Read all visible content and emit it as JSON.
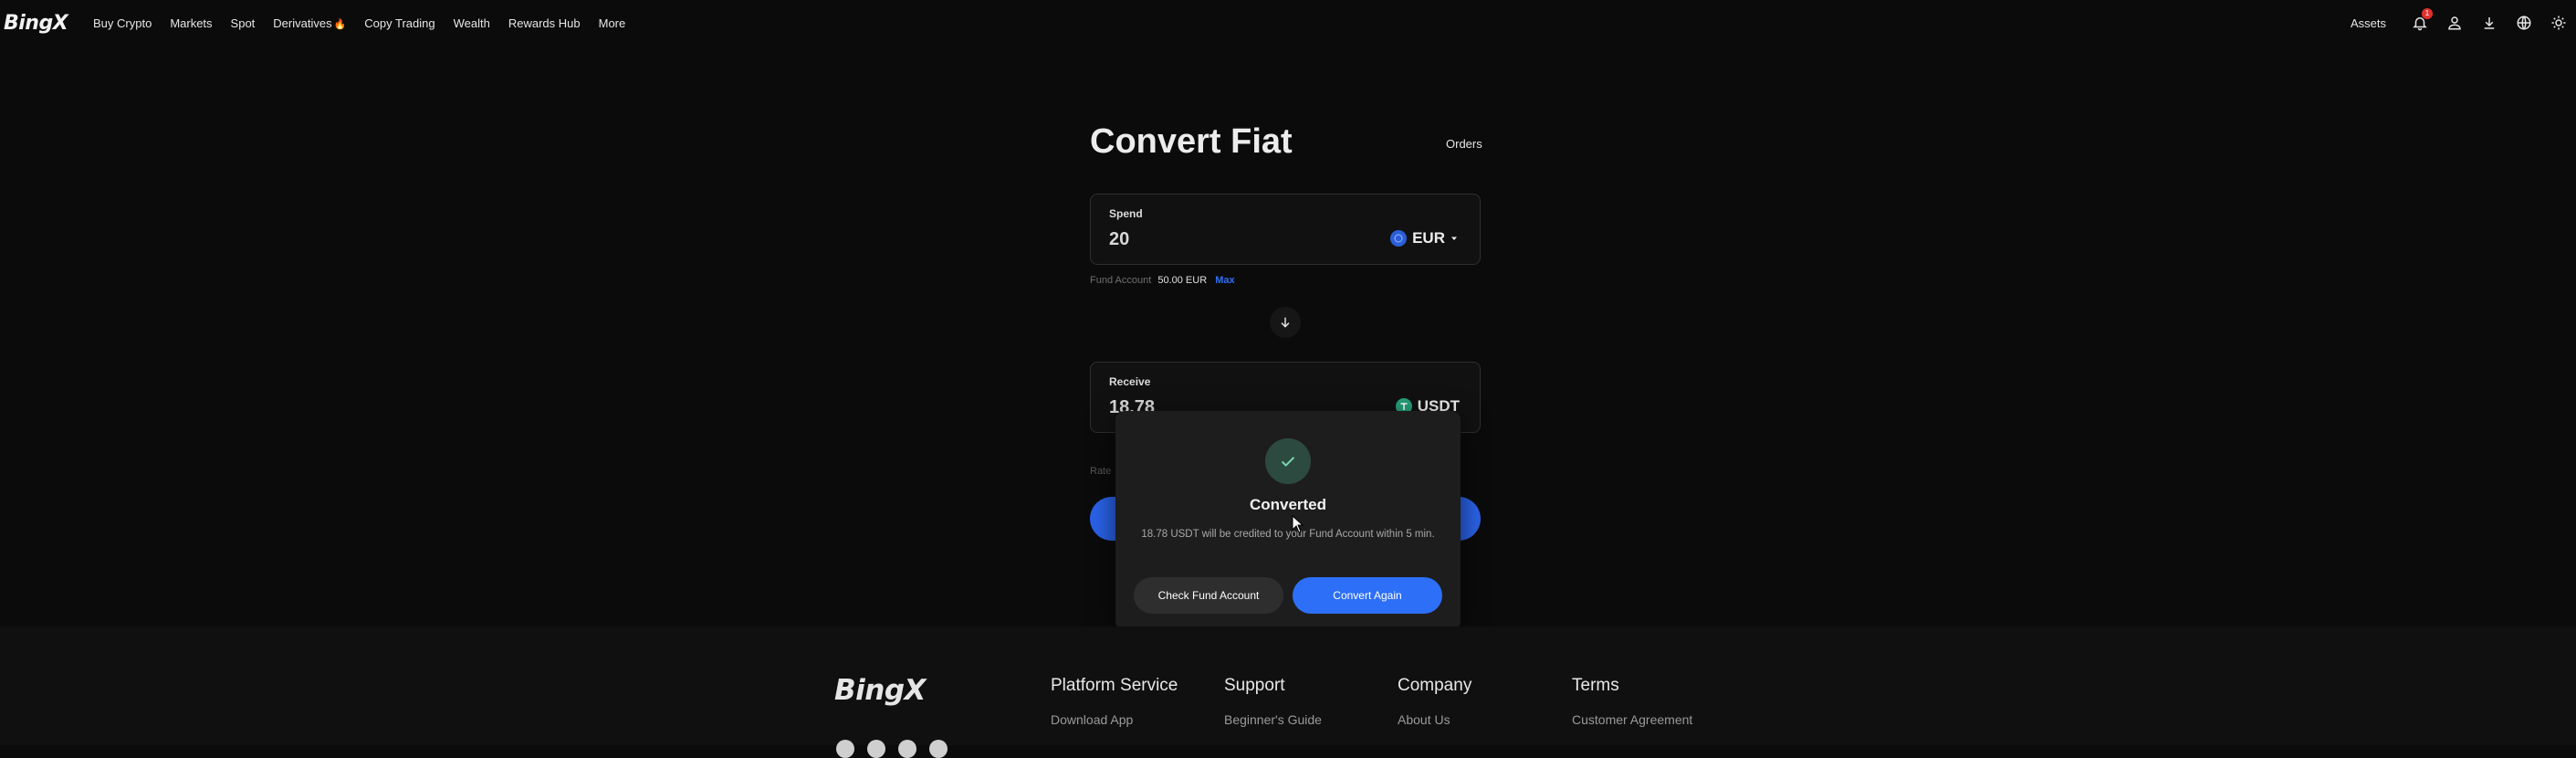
{
  "header": {
    "logo": "BingX",
    "nav": [
      {
        "label": "Buy Crypto"
      },
      {
        "label": "Markets"
      },
      {
        "label": "Spot"
      },
      {
        "label": "Derivatives"
      },
      {
        "label": "Copy Trading"
      },
      {
        "label": "Wealth"
      },
      {
        "label": "Rewards Hub"
      },
      {
        "label": "More"
      }
    ],
    "assets_label": "Assets",
    "notification_count": "1",
    "icons": [
      "bell-icon",
      "user-icon",
      "download-icon",
      "globe-icon",
      "sun-icon"
    ]
  },
  "main": {
    "title": "Convert Fiat",
    "orders_label": "Orders",
    "spend": {
      "label": "Spend",
      "value": "20",
      "currency": "EUR",
      "coin_color": "#2b5fd9"
    },
    "fund_account": {
      "label": "Fund Account",
      "amount": "50.00 EUR",
      "max_label": "Max"
    },
    "receive": {
      "label": "Receive",
      "value": "18.78",
      "currency": "USDT",
      "coin_color": "#26a17b"
    },
    "rate_label": "Rate"
  },
  "modal": {
    "title": "Converted",
    "description": "18.78 USDT will be credited to your Fund Account within 5 min.",
    "secondary_button": "Check Fund Account",
    "primary_button": "Convert Again",
    "check_color": "#2c4a40"
  },
  "footer": {
    "logo": "BingX",
    "columns": [
      {
        "title": "Platform Service",
        "first_link": "Download App"
      },
      {
        "title": "Support",
        "first_link": "Beginner's Guide"
      },
      {
        "title": "Company",
        "first_link": "About Us"
      },
      {
        "title": "Terms",
        "first_link": "Customer Agreement"
      }
    ]
  },
  "colors": {
    "accent": "#2d6ff7",
    "background": "#0b0b0b"
  }
}
